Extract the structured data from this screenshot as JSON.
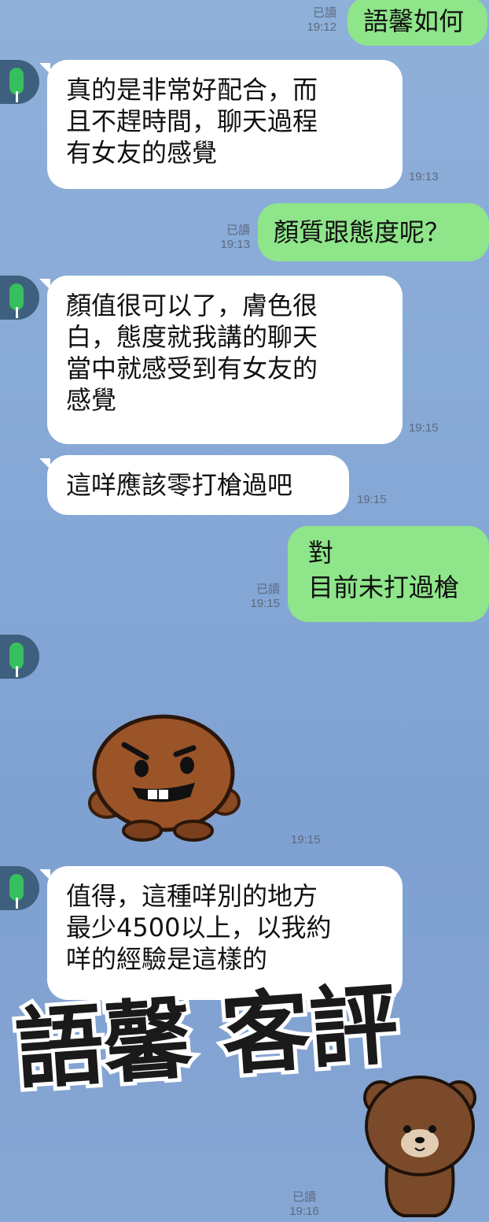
{
  "messages": {
    "m1": {
      "lines": [
        "語馨如何"
      ],
      "read": "已讀",
      "time": "19:12"
    },
    "m2": {
      "lines": [
        "真的是非常好配合，而",
        "且不趕時間，聊天過程",
        "有女友的感覺"
      ],
      "time": "19:13"
    },
    "m3": {
      "lines": [
        "顏質跟態度呢？"
      ],
      "read": "已讀",
      "time": "19:13"
    },
    "m4": {
      "lines": [
        "顏值很可以了，膚色很",
        "白，態度就我講的聊天",
        "當中就感受到有女友的",
        "感覺"
      ],
      "time": "19:15"
    },
    "m5": {
      "lines": [
        "這咩應該零打槍過吧"
      ],
      "time": "19:15"
    },
    "m6": {
      "lines": [
        "對",
        "目前未打過槍"
      ],
      "read": "已讀",
      "time": "19:15"
    },
    "m7": {
      "time": "19:15"
    },
    "m8": {
      "lines": [
        "值得，這種咩別的地方",
        "最少4500以上，以我約",
        "咩的經驗是這樣的"
      ]
    },
    "m9": {
      "read": "已讀",
      "time": "19:16"
    }
  },
  "watermark": {
    "text": "語馨 客評"
  },
  "icons": {
    "avatar": "traffic-light-avatar-icon",
    "sticker_1": "cookie-character-sticker",
    "sticker_2": "bear-character-sticker"
  },
  "colors": {
    "incoming": "#ffffff",
    "outgoing": "#8fe58a",
    "background": "#86a8d6"
  }
}
